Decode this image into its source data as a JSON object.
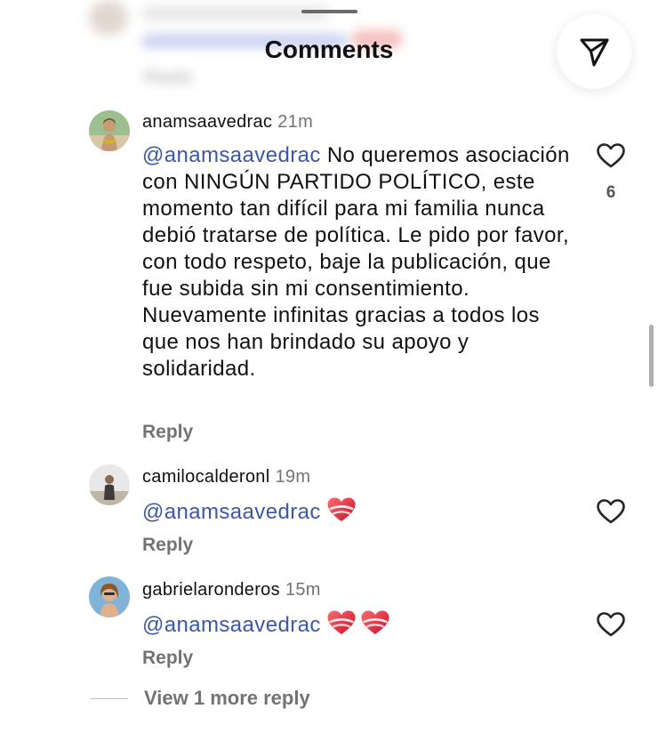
{
  "sheet": {
    "title": "Comments",
    "share_icon": "send-icon"
  },
  "previous_comment": {
    "reply_label": "Reply"
  },
  "comments": [
    {
      "username": "anamsaavedrac",
      "time": "21m",
      "mention": "@anamsaavedrac",
      "text": "No queremos asociación con NINGÚN PARTIDO POLÍTICO, este momento tan difícil para mi familia nunca debió tratarse de política. Le pido por favor, con todo respeto, baje la publicación, que fue subida sin mi consentimiento. Nuevamente infinitas gracias a todos los que nos han brindado su apoyo y solidaridad.",
      "reply_label": "Reply",
      "likes": "6"
    },
    {
      "username": "camilocalderonl",
      "time": "19m",
      "mention": "@anamsaavedrac",
      "emojis": [
        "heart-emoji"
      ],
      "reply_label": "Reply"
    },
    {
      "username": "gabrielaronderos",
      "time": "15m",
      "mention": "@anamsaavedrac",
      "emojis": [
        "heart-emoji",
        "heart-emoji"
      ],
      "reply_label": "Reply"
    }
  ],
  "view_more_replies": "View 1 more reply",
  "colors": {
    "mention": "#3d57a8",
    "secondary_text": "#737373",
    "primary_text": "#111111"
  }
}
